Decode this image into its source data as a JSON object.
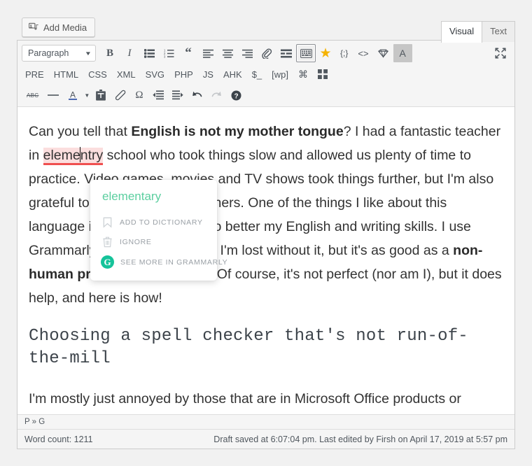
{
  "media": {
    "add_media_label": "Add Media",
    "icon": "media-stack-icon"
  },
  "editor_tabs": [
    {
      "label": "Visual",
      "active": true
    },
    {
      "label": "Text",
      "active": false
    }
  ],
  "toolbar": {
    "format_select": {
      "value": "Paragraph",
      "caret": "▼"
    },
    "row1": [
      {
        "name": "bold-button",
        "glyph": "B",
        "kind": "text-bold"
      },
      {
        "name": "italic-button",
        "glyph": "I",
        "kind": "text-italic"
      },
      {
        "name": "bulleted-list-button",
        "glyph": "ul-icon",
        "kind": "icon"
      },
      {
        "name": "numbered-list-button",
        "glyph": "ol-icon",
        "kind": "icon"
      },
      {
        "name": "blockquote-button",
        "glyph": "“",
        "kind": "quote"
      },
      {
        "name": "align-left-button",
        "glyph": "align-left-icon",
        "kind": "icon"
      },
      {
        "name": "align-center-button",
        "glyph": "align-center-icon",
        "kind": "icon"
      },
      {
        "name": "align-right-button",
        "glyph": "align-right-icon",
        "kind": "icon"
      },
      {
        "name": "insert-link-button",
        "glyph": "paperclip-icon",
        "kind": "icon"
      },
      {
        "name": "insert-read-more-button",
        "glyph": "read-more-icon",
        "kind": "icon"
      },
      {
        "name": "keyboard-shortcuts-button",
        "glyph": "keyboard-icon",
        "kind": "icon",
        "pressed": true
      },
      {
        "name": "favorite-button",
        "glyph": "★",
        "kind": "star"
      },
      {
        "name": "shortcode-button",
        "glyph": "{;}",
        "kind": "text"
      },
      {
        "name": "code-button",
        "glyph": "<>",
        "kind": "text"
      },
      {
        "name": "gem-button",
        "glyph": "gem-icon",
        "kind": "icon"
      },
      {
        "name": "text-tool-button",
        "glyph": "A",
        "kind": "text",
        "shaded": true
      },
      {
        "name": "fullscreen-button",
        "glyph": "fullscreen-icon",
        "kind": "icon"
      }
    ],
    "row2": [
      "PRE",
      "HTML",
      "CSS",
      "XML",
      "SVG",
      "PHP",
      "JS",
      "AHK",
      "$_",
      "[wp]"
    ],
    "row2_icons": [
      {
        "name": "command-button",
        "glyph": "⌘"
      },
      {
        "name": "grid-blocks-button",
        "glyph": "grid-icon"
      }
    ],
    "row3": [
      {
        "name": "strikethrough-button",
        "glyph": "ABC",
        "kind": "abc"
      },
      {
        "name": "horizontal-rule-button",
        "glyph": "hr-icon",
        "kind": "icon"
      },
      {
        "name": "text-color-button",
        "glyph": "A-underline-icon",
        "kind": "icon"
      },
      {
        "name": "text-color-caret",
        "glyph": "▼",
        "kind": "caret"
      },
      {
        "name": "paste-as-text-button",
        "glyph": "clipboard-icon",
        "kind": "icon"
      },
      {
        "name": "clear-formatting-button",
        "glyph": "eraser-icon",
        "kind": "icon"
      },
      {
        "name": "special-character-button",
        "glyph": "Ω",
        "kind": "omega"
      },
      {
        "name": "decrease-indent-button",
        "glyph": "outdent-icon",
        "kind": "icon"
      },
      {
        "name": "increase-indent-button",
        "glyph": "indent-icon",
        "kind": "icon"
      },
      {
        "name": "undo-button",
        "glyph": "undo-icon",
        "kind": "icon"
      },
      {
        "name": "redo-button",
        "glyph": "redo-icon",
        "kind": "icon",
        "disabled": true
      },
      {
        "name": "help-button",
        "glyph": "help-icon",
        "kind": "icon"
      }
    ]
  },
  "document": {
    "para1": {
      "before": "Can you tell that ",
      "bold": "English is not my mother tongue",
      "after": "? I had a fantastic teacher in ",
      "misspelled_a": "eleme",
      "misspelled_b": "ntry",
      "after2": " school who took things slow and allowed us plenty of time to practice. Video games, movies and TV shows took things further, but I'm also grateful to my high school teachers. One of the things I like about this language is that it pushes me to better my English and writing skills. I use Grammarly for that. It's not that I'm lost without it, but it's as good as a "
    },
    "para1_bold2": "non-human proofreader",
    "para1_tail": " could be. Of course, it's not perfect (nor am I), but it does help, and here is how!",
    "heading": "Choosing a spell checker that's not run-of-the-mill",
    "para2": "I'm mostly just annoyed by those that are in Microsoft Office products or"
  },
  "grammarly_popup": {
    "suggestion": "elementary",
    "items": [
      {
        "name": "add-to-dictionary",
        "label": "ADD TO DICTIONARY",
        "icon": "bookmark-icon"
      },
      {
        "name": "ignore",
        "label": "IGNORE",
        "icon": "trash-icon"
      },
      {
        "name": "see-more-in-grammarly",
        "label": "SEE MORE IN GRAMMARLY",
        "icon": "grammarly-g-icon"
      }
    ],
    "accent_color": "#15c39a",
    "suggestion_color": "#5ccfa0"
  },
  "path_bar": {
    "text": "P » G"
  },
  "status_bar": {
    "word_count": "Word count: 1211",
    "saved": "Draft saved at 6:07:04 pm. Last edited by Firsh on April 17, 2019 at 5:57 pm"
  },
  "colors": {
    "page_bg": "#f1f1f1",
    "toolbar_bg": "#f5f5f5",
    "border": "#cccccc",
    "misspell_bg": "#fbdede",
    "misspell_underline": "#ef4f4f",
    "star": "#f5b301"
  }
}
